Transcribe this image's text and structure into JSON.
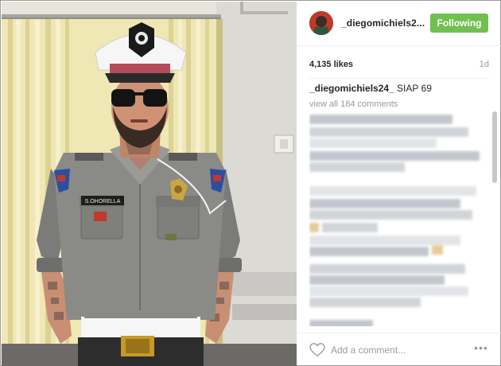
{
  "post": {
    "header": {
      "username": "_diegomichiels2...",
      "follow_label": "Following",
      "follow_color": "#70c050"
    },
    "likes": "4,135 likes",
    "age": "1d",
    "caption": {
      "username": "_diegomichiels24_",
      "text": " SIAP 69"
    },
    "view_all_comments": "view all 184 comments",
    "comment_input": {
      "placeholder": "Add a comment..."
    },
    "more_label": "•••",
    "icons": {
      "like": "heart-icon",
      "more": "more-options-icon"
    }
  },
  "photo": {
    "name_tag": "S.OHORELLA"
  }
}
